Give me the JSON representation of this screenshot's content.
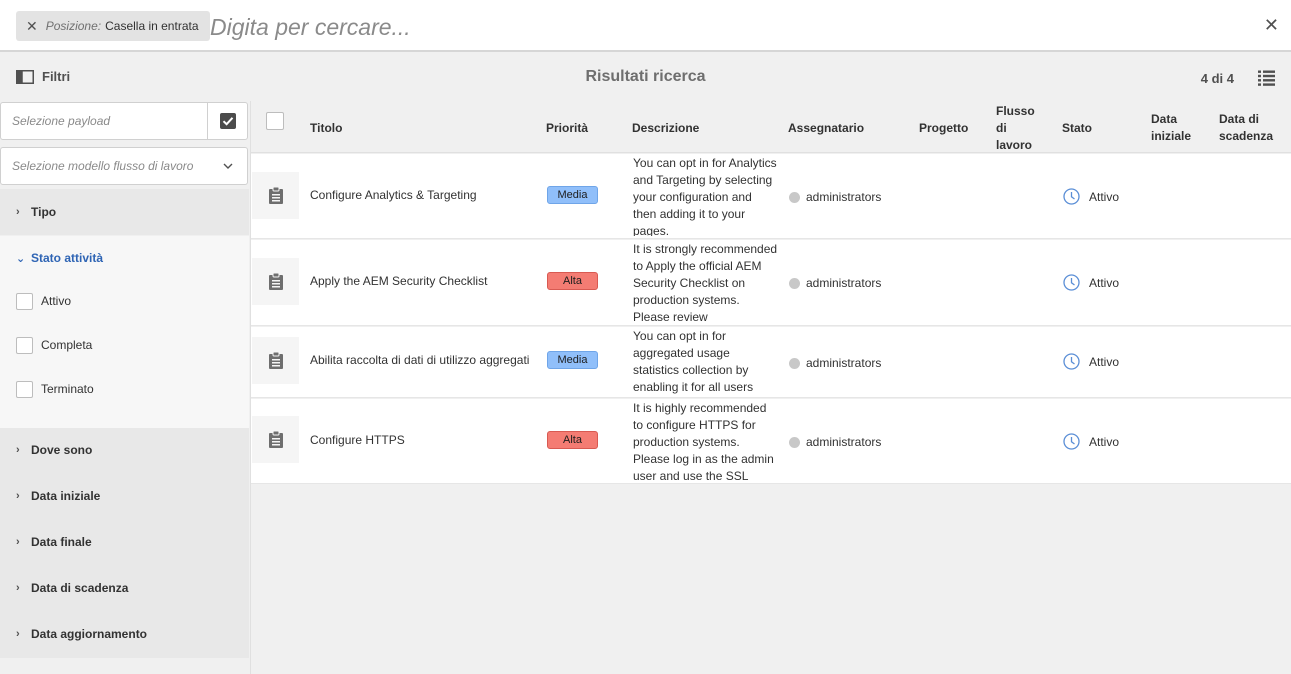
{
  "search": {
    "tag_key": "Posizione:",
    "tag_value": "Casella in entrata",
    "placeholder": "Digita per cercare..."
  },
  "actionbar": {
    "filters_label": "Filtri",
    "title": "Risultati ricerca",
    "count": "4 di 4"
  },
  "rail": {
    "payload_placeholder": "Selezione payload",
    "model_label": "Selezione modello flusso di lavoro",
    "sections": {
      "tipo": "Tipo",
      "stato": "Stato attività",
      "dove": "Dove sono",
      "data_iniziale": "Data iniziale",
      "data_finale": "Data finale",
      "data_scadenza": "Data di scadenza",
      "data_aggiornamento": "Data aggiornamento"
    },
    "stato_options": [
      "Attivo",
      "Completa",
      "Terminato"
    ]
  },
  "table": {
    "headers": {
      "titolo": "Titolo",
      "priorita": "Priorità",
      "descrizione": "Descrizione",
      "assegnatario": "Assegnatario",
      "progetto": "Progetto",
      "flusso": "Flusso di lavoro",
      "stato": "Stato",
      "data_iniziale": "Data iniziale",
      "data_scadenza": "Data di scadenza"
    },
    "rows": [
      {
        "title": "Configure Analytics & Targeting",
        "priority": "Media",
        "description": "You can opt in for Analytics and Targeting by selecting your configuration and then adding it to your pages.",
        "assignee": "administrators",
        "status": "Attivo"
      },
      {
        "title": "Apply the AEM Security Checklist",
        "priority": "Alta",
        "description": "It is strongly recommended to Apply the official AEM Security Checklist on production systems. Please review",
        "assignee": "administrators",
        "status": "Attivo"
      },
      {
        "title": "Abilita raccolta di dati di utilizzo aggregati",
        "priority": "Media",
        "description": "You can opt in for aggregated usage statistics collection by enabling it for all users",
        "assignee": "administrators",
        "status": "Attivo"
      },
      {
        "title": "Configure HTTPS",
        "priority": "Alta",
        "description": "It is highly recommended to configure HTTPS for production systems. Please log in as the admin user and use the SSL",
        "assignee": "administrators",
        "status": "Attivo"
      }
    ]
  },
  "colors": {
    "accent": "#2e64b4",
    "priority_media": "#90bffa",
    "priority_alta": "#f47c73"
  }
}
